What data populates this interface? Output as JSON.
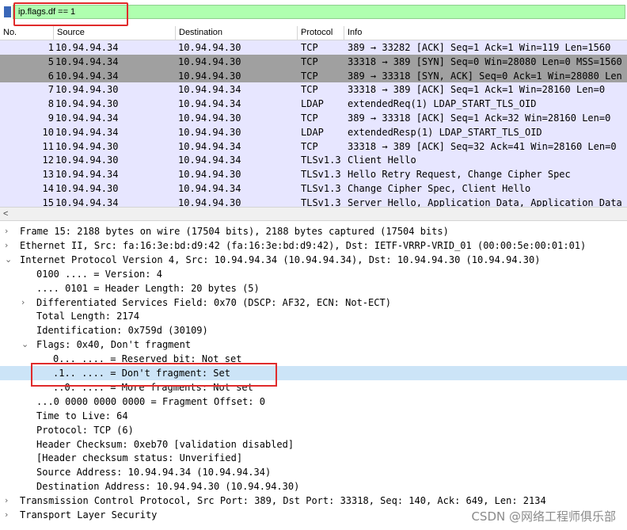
{
  "filter": {
    "value": "ip.flags.df == 1"
  },
  "columns": {
    "no": "No.",
    "source": "Source",
    "destination": "Destination",
    "protocol": "Protocol",
    "info": "Info"
  },
  "packets": [
    {
      "no": "1",
      "src": "10.94.94.34",
      "dst": "10.94.94.30",
      "proto": "TCP",
      "info": "389 → 33282 [ACK] Seq=1 Ack=1 Win=119 Len=1560",
      "style": "tcp"
    },
    {
      "no": "5",
      "src": "10.94.94.34",
      "dst": "10.94.94.30",
      "proto": "TCP",
      "info": "33318 → 389 [SYN] Seq=0 Win=28080 Len=0 MSS=1560",
      "style": "syn"
    },
    {
      "no": "6",
      "src": "10.94.94.34",
      "dst": "10.94.94.30",
      "proto": "TCP",
      "info": "389 → 33318 [SYN, ACK] Seq=0 Ack=1 Win=28080 Len",
      "style": "syn"
    },
    {
      "no": "7",
      "src": "10.94.94.30",
      "dst": "10.94.94.34",
      "proto": "TCP",
      "info": "33318 → 389 [ACK] Seq=1 Ack=1 Win=28160 Len=0",
      "style": "tcp"
    },
    {
      "no": "8",
      "src": "10.94.94.30",
      "dst": "10.94.94.34",
      "proto": "LDAP",
      "info": "extendedReq(1) LDAP_START_TLS_OID",
      "style": "ldap"
    },
    {
      "no": "9",
      "src": "10.94.94.34",
      "dst": "10.94.94.30",
      "proto": "TCP",
      "info": "389 → 33318 [ACK] Seq=1 Ack=32 Win=28160 Len=0",
      "style": "tcp"
    },
    {
      "no": "10",
      "src": "10.94.94.34",
      "dst": "10.94.94.30",
      "proto": "LDAP",
      "info": "extendedResp(1) LDAP_START_TLS_OID",
      "style": "ldap"
    },
    {
      "no": "11",
      "src": "10.94.94.30",
      "dst": "10.94.94.34",
      "proto": "TCP",
      "info": "33318 → 389 [ACK] Seq=32 Ack=41 Win=28160 Len=0",
      "style": "tcp"
    },
    {
      "no": "12",
      "src": "10.94.94.30",
      "dst": "10.94.94.34",
      "proto": "TLSv1.3",
      "info": "Client Hello",
      "style": "tls"
    },
    {
      "no": "13",
      "src": "10.94.94.34",
      "dst": "10.94.94.30",
      "proto": "TLSv1.3",
      "info": "Hello Retry Request, Change Cipher Spec",
      "style": "tls"
    },
    {
      "no": "14",
      "src": "10.94.94.30",
      "dst": "10.94.94.34",
      "proto": "TLSv1.3",
      "info": "Change Cipher Spec, Client Hello",
      "style": "tls"
    },
    {
      "no": "15",
      "src": "10.94.94.34",
      "dst": "10.94.94.30",
      "proto": "TLSv1.3",
      "info": "Server Hello, Application Data, Application Data",
      "style": "tls"
    }
  ],
  "row_colors": {
    "tcp": "#e7e6ff",
    "syn": "#a0a0a0",
    "ldap": "#e7e6ff",
    "tls": "#e7e6ff"
  },
  "details": [
    {
      "indent": 0,
      "exp": "›",
      "text": "Frame 15: 2188 bytes on wire (17504 bits), 2188 bytes captured (17504 bits)"
    },
    {
      "indent": 0,
      "exp": "›",
      "text": "Ethernet II, Src: fa:16:3e:bd:d9:42 (fa:16:3e:bd:d9:42), Dst: IETF-VRRP-VRID_01 (00:00:5e:00:01:01)"
    },
    {
      "indent": 0,
      "exp": "⌄",
      "text": "Internet Protocol Version 4, Src: 10.94.94.34 (10.94.94.34), Dst: 10.94.94.30 (10.94.94.30)"
    },
    {
      "indent": 1,
      "exp": "",
      "text": "0100 .... = Version: 4"
    },
    {
      "indent": 1,
      "exp": "",
      "text": ".... 0101 = Header Length: 20 bytes (5)"
    },
    {
      "indent": 1,
      "exp": "›",
      "text": "Differentiated Services Field: 0x70 (DSCP: AF32, ECN: Not-ECT)"
    },
    {
      "indent": 1,
      "exp": "",
      "text": "Total Length: 2174"
    },
    {
      "indent": 1,
      "exp": "",
      "text": "Identification: 0x759d (30109)"
    },
    {
      "indent": 1,
      "exp": "⌄",
      "text": "Flags: 0x40, Don't fragment"
    },
    {
      "indent": 2,
      "exp": "",
      "text": "0... .... = Reserved bit: Not set"
    },
    {
      "indent": 2,
      "exp": "",
      "text": ".1.. .... = Don't fragment: Set",
      "selected": true
    },
    {
      "indent": 2,
      "exp": "",
      "text": "..0. .... = More fragments: Not set"
    },
    {
      "indent": 1,
      "exp": "",
      "text": "...0 0000 0000 0000 = Fragment Offset: 0"
    },
    {
      "indent": 1,
      "exp": "",
      "text": "Time to Live: 64"
    },
    {
      "indent": 1,
      "exp": "",
      "text": "Protocol: TCP (6)"
    },
    {
      "indent": 1,
      "exp": "",
      "text": "Header Checksum: 0xeb70 [validation disabled]"
    },
    {
      "indent": 1,
      "exp": "",
      "text": "[Header checksum status: Unverified]"
    },
    {
      "indent": 1,
      "exp": "",
      "text": "Source Address: 10.94.94.34 (10.94.94.34)"
    },
    {
      "indent": 1,
      "exp": "",
      "text": "Destination Address: 10.94.94.30 (10.94.94.30)"
    },
    {
      "indent": 0,
      "exp": "›",
      "text": "Transmission Control Protocol, Src Port: 389, Dst Port: 33318, Seq: 140, Ack: 649, Len: 2134"
    },
    {
      "indent": 0,
      "exp": "›",
      "text": "Transport Layer Security"
    }
  ],
  "selected_color": "#cce4f7",
  "watermark": "CSDN @网络工程师俱乐部"
}
